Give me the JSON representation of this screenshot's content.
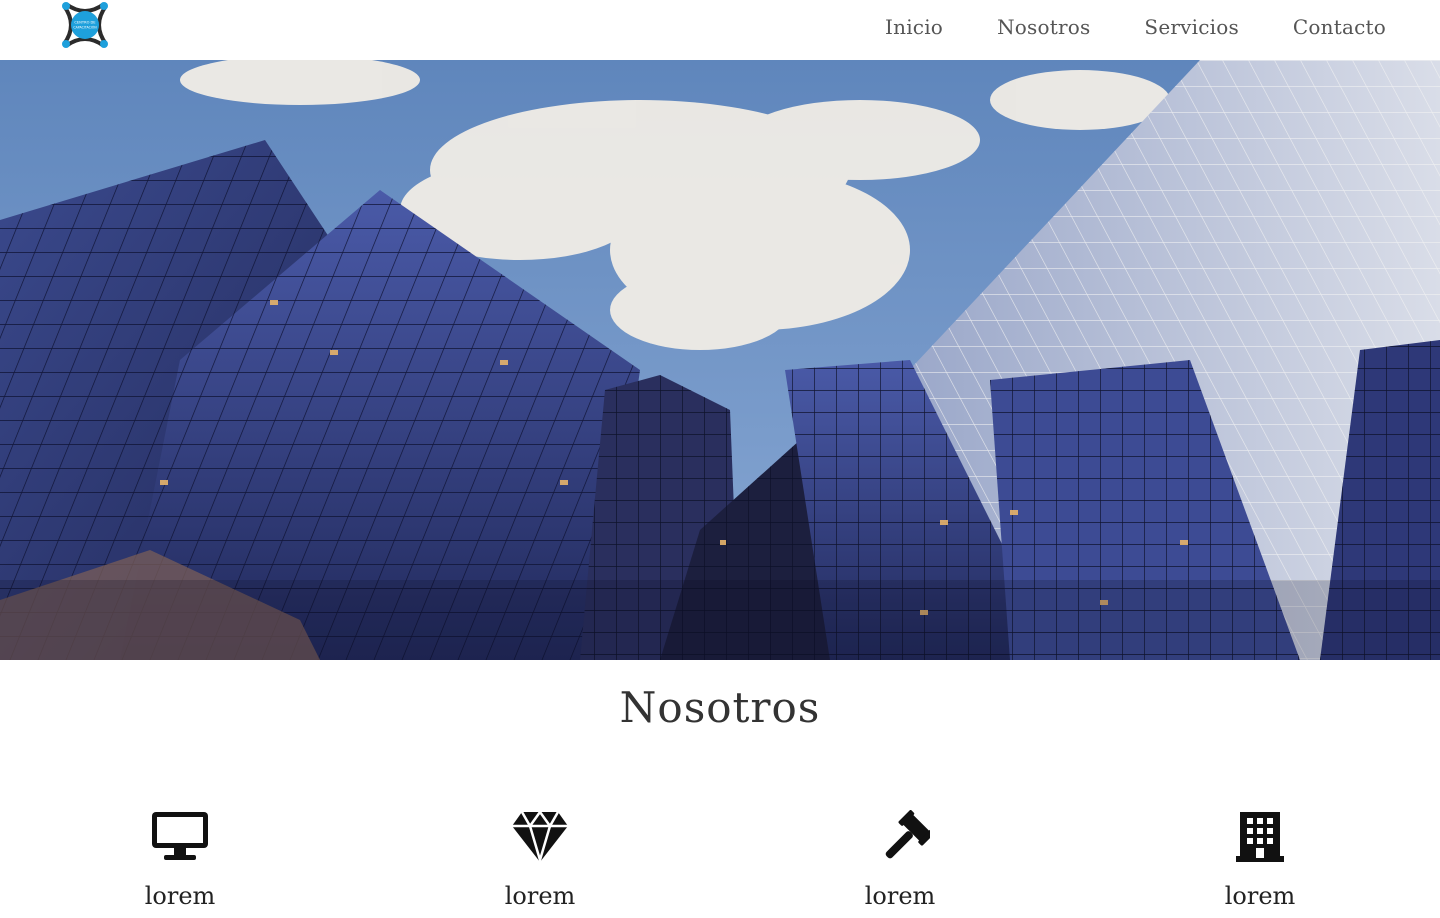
{
  "header": {
    "logo_text_line1": "CENTRO DE",
    "logo_text_line2": "CAPACITACIÓN",
    "nav": [
      {
        "label": "Inicio"
      },
      {
        "label": "Nosotros"
      },
      {
        "label": "Servicios"
      },
      {
        "label": "Contacto"
      }
    ]
  },
  "colors": {
    "logo_accent": "#1ea0dc",
    "logo_dark": "#2b2b2b",
    "icon": "#111111"
  },
  "about": {
    "title": "Nosotros",
    "features": [
      {
        "icon": "desktop-icon",
        "label": "lorem"
      },
      {
        "icon": "diamond-icon",
        "label": "lorem"
      },
      {
        "icon": "gavel-icon",
        "label": "lorem"
      },
      {
        "icon": "building-icon",
        "label": "lorem"
      }
    ]
  }
}
